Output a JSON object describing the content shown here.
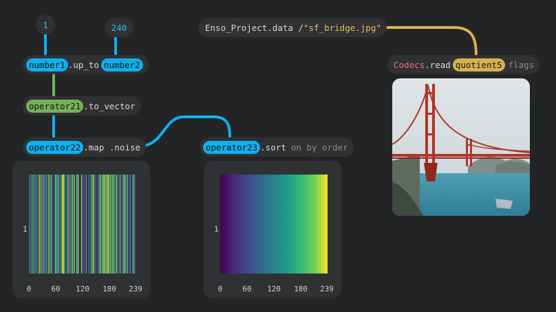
{
  "nodes": {
    "num1": "1",
    "num240": "240",
    "up_to": {
      "arg1": "number1",
      "method": ".up_to",
      "arg2": "number2"
    },
    "to_vector": {
      "arg": "operator21",
      "method": ".to_vector"
    },
    "map_noise": {
      "arg": "operator22",
      "method": ".map .noise"
    },
    "sort": {
      "arg": "operator23",
      "method": ".sort",
      "rest": "on by order"
    },
    "enso": {
      "text": "Enso_Project.data / ",
      "str": "\"sf_bridge.jpg\""
    },
    "codecs": {
      "type": "Codecs",
      "method": ".read",
      "arg": "quotient5",
      "rest": "flags"
    }
  },
  "colors": {
    "blue": "#0fb0ee",
    "green": "#74b25a",
    "gold": "#d7b24f",
    "background": "#232426",
    "node": "#303133"
  },
  "chart_data": [
    {
      "type": "heatmap",
      "description_free": "",
      "x": {
        "min": 0,
        "max": 239
      },
      "ticks": [
        "0",
        "60",
        "120",
        "180",
        "239"
      ],
      "ylabel_tick": "1",
      "colormap": "viridis",
      "pattern": "random noise"
    },
    {
      "type": "heatmap",
      "x": {
        "min": 0,
        "max": 239
      },
      "ticks": [
        "0",
        "60",
        "120",
        "180",
        "239"
      ],
      "ylabel_tick": "1",
      "colormap": "viridis",
      "pattern": "sorted ascending"
    }
  ],
  "image": {
    "subject": "golden-gate-bridge-photo"
  }
}
